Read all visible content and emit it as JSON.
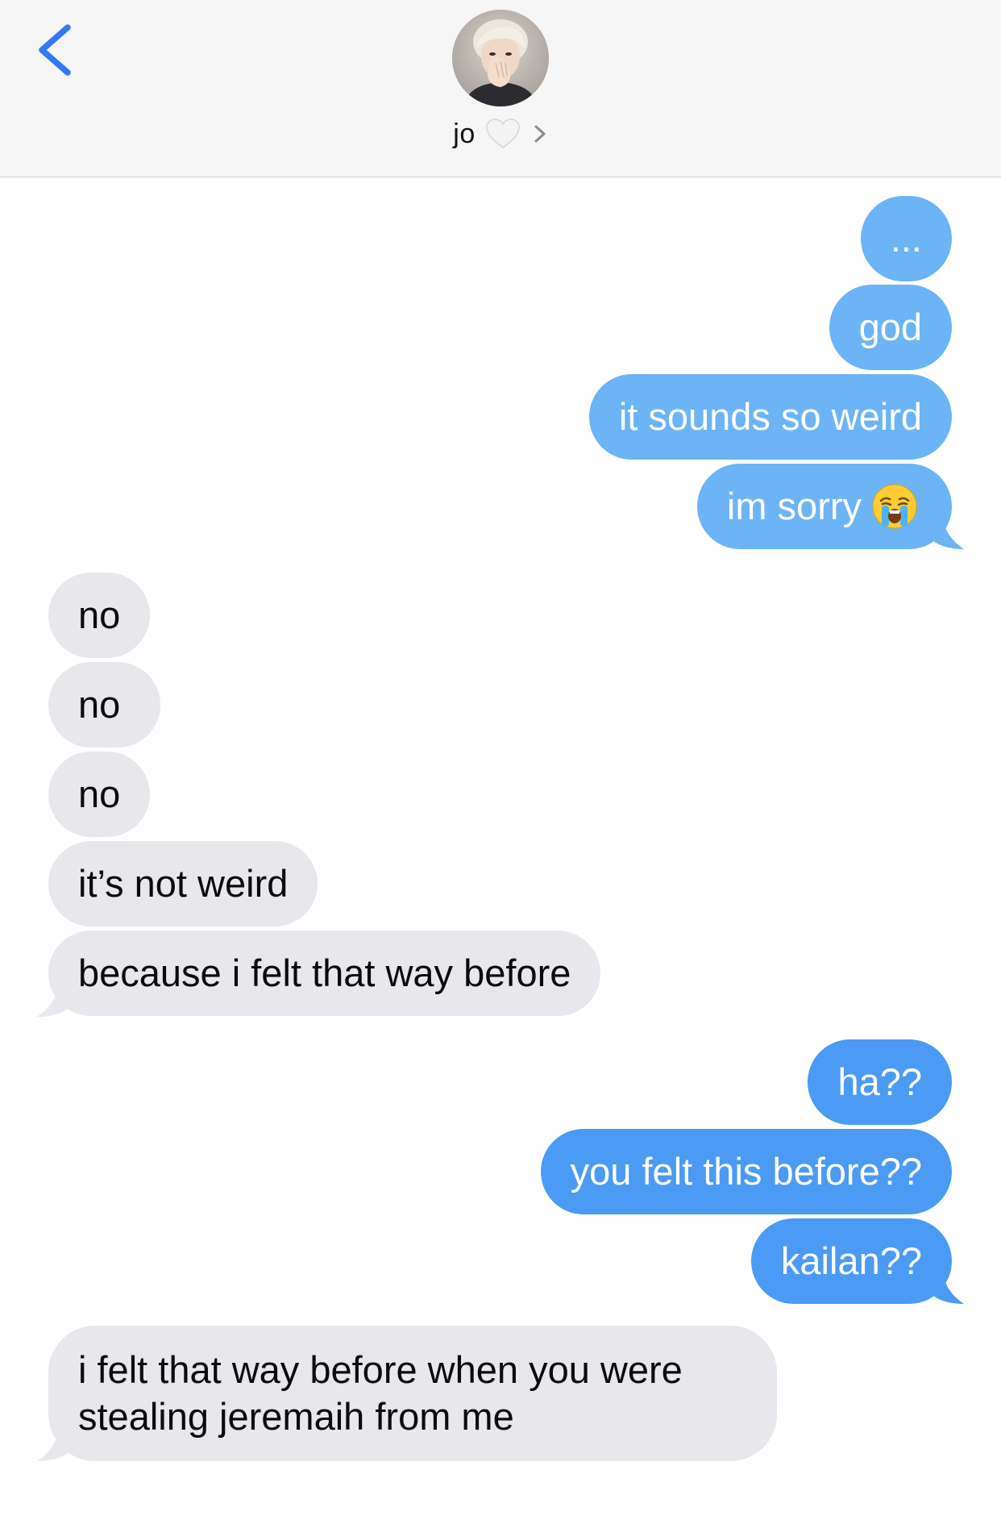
{
  "header": {
    "contact_name": "jo",
    "back_icon": "chevron-left-icon",
    "heart_icon": "white-heart-icon",
    "chevron_icon": "chevron-right-icon",
    "accent_color": "#3478f6"
  },
  "colors": {
    "sent_bubble": "#4b9af4",
    "sent_bubble_light": "#6cb4f5",
    "received_bubble": "#e8e8ec"
  },
  "messages": [
    {
      "from": "me",
      "text": "..."
    },
    {
      "from": "me",
      "text": "god"
    },
    {
      "from": "me",
      "text": "it sounds so weird"
    },
    {
      "from": "me",
      "text": "im sorry",
      "emoji": "loudly-crying-face-icon"
    },
    {
      "from": "them",
      "text": "no"
    },
    {
      "from": "them",
      "text": "no"
    },
    {
      "from": "them",
      "text": "no"
    },
    {
      "from": "them",
      "text": "it’s not weird"
    },
    {
      "from": "them",
      "text": "because i felt that way before"
    },
    {
      "from": "me",
      "text": "ha??"
    },
    {
      "from": "me",
      "text": "you felt this before??"
    },
    {
      "from": "me",
      "text": "kailan??"
    },
    {
      "from": "them",
      "text": "i felt that way before when you were stealing jeremaih from me"
    }
  ]
}
